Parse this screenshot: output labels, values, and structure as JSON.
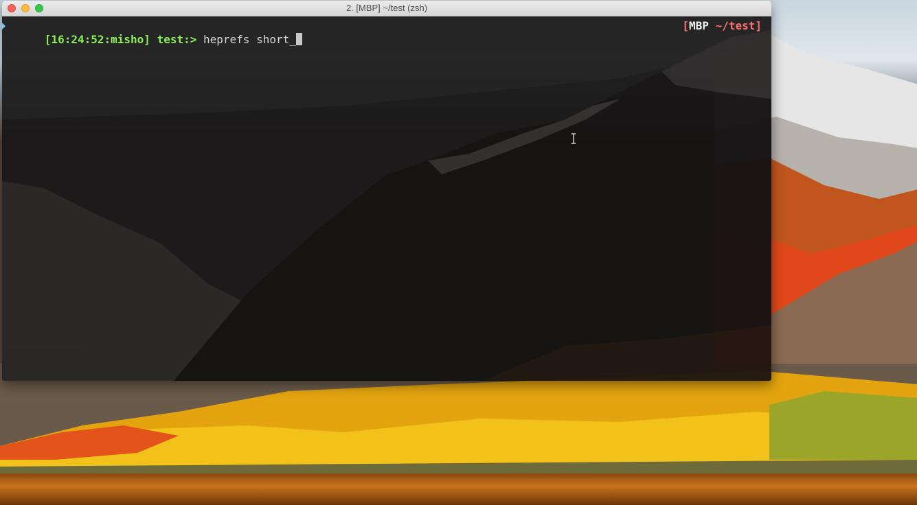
{
  "window": {
    "title": "2.  [MBP] ~/test  (zsh)"
  },
  "terminal": {
    "prompt": {
      "time_user": "[16:24:52:misho]",
      "dir": "test:>",
      "command": "heprefs short_"
    },
    "right_prompt": {
      "open_bracket": "[",
      "host": "MBP",
      "path": "~/test",
      "close_bracket": "]"
    }
  },
  "colors": {
    "prompt_green": "#8af05a",
    "right_prompt_red": "#ff6e6e",
    "terminal_bg": "#141212",
    "close": "#fc605c",
    "minimize": "#fdbc40",
    "zoom": "#34c84a"
  },
  "icons": {
    "close": "close-icon",
    "minimize": "minimize-icon",
    "zoom": "zoom-icon",
    "text_cursor": "ibeam-cursor-icon"
  }
}
